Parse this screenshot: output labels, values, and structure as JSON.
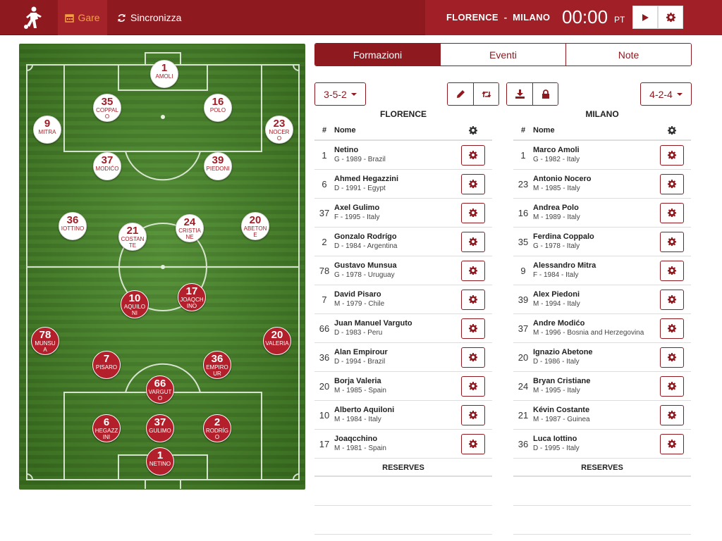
{
  "header": {
    "nav_gare": "Gare",
    "nav_sync": "Sincronizza",
    "match_title": "FLORENCE  -  MILANO",
    "clock": "00:00",
    "period": "PT",
    "play_icon": "play-icon",
    "settings_icon": "gear-icon"
  },
  "tabs": [
    {
      "label": "Formazioni",
      "active": true
    },
    {
      "label": "Eventi",
      "active": false
    },
    {
      "label": "Note",
      "active": false
    }
  ],
  "formation_home": "3-5-2",
  "formation_away": "4-2-4",
  "colors": {
    "primary": "#8e1a20",
    "accent": "#f2a13b",
    "pitch": "#4b8b2a"
  },
  "pitch_players": {
    "home": [
      {
        "num": "1",
        "name": "AMOLI"
      },
      {
        "num": "35",
        "name": "COPPALO"
      },
      {
        "num": "16",
        "name": "POLO"
      },
      {
        "num": "9",
        "name": "MITRA"
      },
      {
        "num": "23",
        "name": "NOCERO"
      },
      {
        "num": "37",
        "name": "MODIĆO"
      },
      {
        "num": "39",
        "name": "PIEDONI"
      },
      {
        "num": "36",
        "name": "IOTTINO"
      },
      {
        "num": "21",
        "name": "COSTANTE"
      },
      {
        "num": "24",
        "name": "CRISTIANE"
      },
      {
        "num": "20",
        "name": "ABETONE"
      }
    ],
    "away": [
      {
        "num": "10",
        "name": "AQUILONI"
      },
      {
        "num": "17",
        "name": "JOAQCHINO"
      },
      {
        "num": "78",
        "name": "MUNSUA"
      },
      {
        "num": "20",
        "name": "VALERIA"
      },
      {
        "num": "7",
        "name": "PISARO"
      },
      {
        "num": "36",
        "name": "EMPIROUR"
      },
      {
        "num": "66",
        "name": "VARGUTO"
      },
      {
        "num": "6",
        "name": "HEGAZZINI"
      },
      {
        "num": "37",
        "name": "GULIMO"
      },
      {
        "num": "2",
        "name": "RODRÍGO"
      },
      {
        "num": "1",
        "name": "NETINO"
      }
    ]
  },
  "teams": [
    {
      "name": "FLORENCE",
      "col_num": "#",
      "col_name": "Nome",
      "reserves_label": "RESERVES",
      "players": [
        {
          "num": "1",
          "name": "Netino",
          "info": "G - 1989 - Brazil"
        },
        {
          "num": "6",
          "name": "Ahmed Hegazzini",
          "info": "D - 1991 - Egypt"
        },
        {
          "num": "37",
          "name": "Axel Gulimo",
          "info": "F - 1995 - Italy"
        },
        {
          "num": "2",
          "name": "Gonzalo Rodrígo",
          "info": "D - 1984 - Argentina"
        },
        {
          "num": "78",
          "name": "Gustavo Munsua",
          "info": "G - 1978 - Uruguay"
        },
        {
          "num": "7",
          "name": "David Pisaro",
          "info": "M - 1979 - Chile"
        },
        {
          "num": "66",
          "name": "Juan Manuel Varguto",
          "info": "D - 1983 - Peru"
        },
        {
          "num": "36",
          "name": "Alan Empirour",
          "info": "D - 1994 - Brazil"
        },
        {
          "num": "20",
          "name": "Borja Valeria",
          "info": "M - 1985 - Spain"
        },
        {
          "num": "10",
          "name": "Alberto Aquiloni",
          "info": "M - 1984 - Italy"
        },
        {
          "num": "17",
          "name": "Joaqcchino",
          "info": "M - 1981 - Spain"
        }
      ]
    },
    {
      "name": "MILANO",
      "col_num": "#",
      "col_name": "Nome",
      "reserves_label": "RESERVES",
      "players": [
        {
          "num": "1",
          "name": "Marco Amoli",
          "info": "G - 1982 - Italy"
        },
        {
          "num": "23",
          "name": "Antonio Nocero",
          "info": "M - 1985 - Italy"
        },
        {
          "num": "16",
          "name": "Andrea Polo",
          "info": "M - 1989 - Italy"
        },
        {
          "num": "35",
          "name": "Ferdina Coppalo",
          "info": "G - 1978 - Italy"
        },
        {
          "num": "9",
          "name": "Alessandro Mitra",
          "info": "F - 1984 - Italy"
        },
        {
          "num": "39",
          "name": "Alex Piedoni",
          "info": "M - 1994 - Italy"
        },
        {
          "num": "37",
          "name": "Andre Modićo",
          "info": "M - 1996 - Bosnia and Herzegovina"
        },
        {
          "num": "20",
          "name": "Ignazio Abetone",
          "info": "D - 1986 - Italy"
        },
        {
          "num": "24",
          "name": "Bryan Cristiane",
          "info": "M - 1995 - Italy"
        },
        {
          "num": "21",
          "name": "Kévin Costante",
          "info": "M - 1987 - Guinea"
        },
        {
          "num": "36",
          "name": "Luca Iottino",
          "info": "D - 1995 - Italy"
        }
      ]
    }
  ]
}
